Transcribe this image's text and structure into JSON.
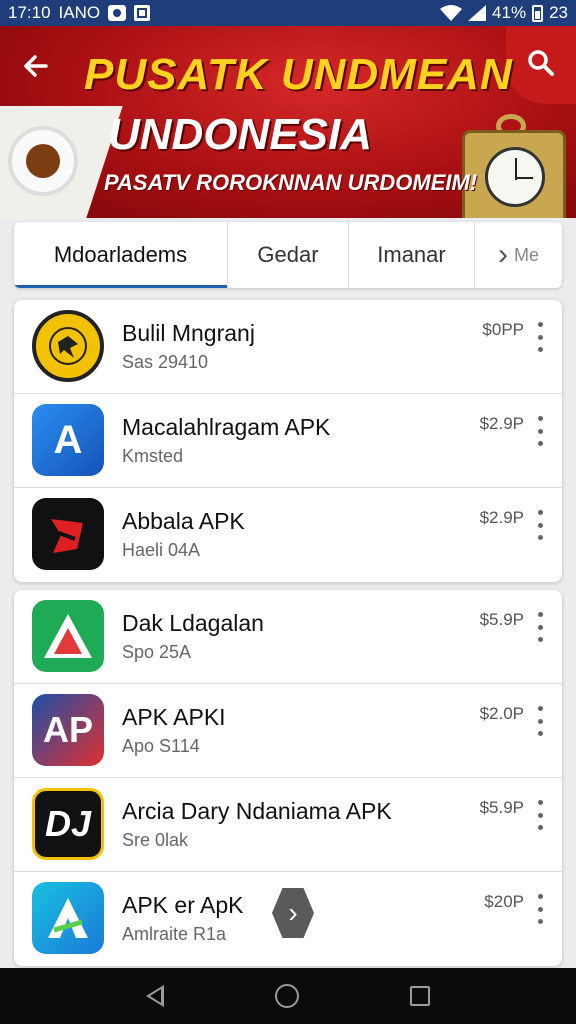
{
  "status_bar": {
    "time": "17:10",
    "carrier": "IANO",
    "battery": "41%",
    "extra": "23"
  },
  "banner": {
    "title_line1": "PUSATK UNDMEAN",
    "title_line2": "UNDONESIA",
    "subtitle": "PASATV ROROKNNAN URDOMEIM!"
  },
  "tabs": [
    {
      "label": "Mdoarladems",
      "active": true
    },
    {
      "label": "Gedar",
      "active": false
    },
    {
      "label": "Imanar",
      "active": false
    },
    {
      "label": "Me",
      "active": false
    }
  ],
  "list_top": [
    {
      "name": "Bulil Mngranj",
      "sub": "Sas 29410",
      "price": "$0PP",
      "icon": "seal-icon",
      "color": "#f2c200"
    },
    {
      "name": "Macalahlragam APK",
      "sub": "Kmsted",
      "price": "$2.9P",
      "icon": "letter-a-icon",
      "color": "#1e6fd9"
    },
    {
      "name": "Abbala APK",
      "sub": "Haeli 04A",
      "price": "$2.9P",
      "icon": "red-mark-icon",
      "color": "#111111"
    }
  ],
  "list_bottom": [
    {
      "name": "Dak Ldagalan",
      "sub": "Spo 25A",
      "price": "$5.9P",
      "icon": "triangle-icon",
      "color": "#1faa55"
    },
    {
      "name": "APK APKI",
      "sub": "Apo S114",
      "price": "$2.0P",
      "icon": "ap-icon",
      "color": "#1d4fa8"
    },
    {
      "name": "Arcia Dary Ndaniama APK",
      "sub": "Sre 0lak",
      "price": "$5.9P",
      "icon": "dj-icon",
      "color": "#111111"
    },
    {
      "name": "APK er ApK",
      "sub": "Amlraite R1a",
      "price": "$20P",
      "icon": "arrow-a-icon",
      "color": "#1aa6e0"
    }
  ],
  "colors": {
    "status_bar": "#1f3d7a",
    "banner_red": "#b81216",
    "banner_yellow": "#ffd21f",
    "tab_indicator": "#1f5fae"
  }
}
